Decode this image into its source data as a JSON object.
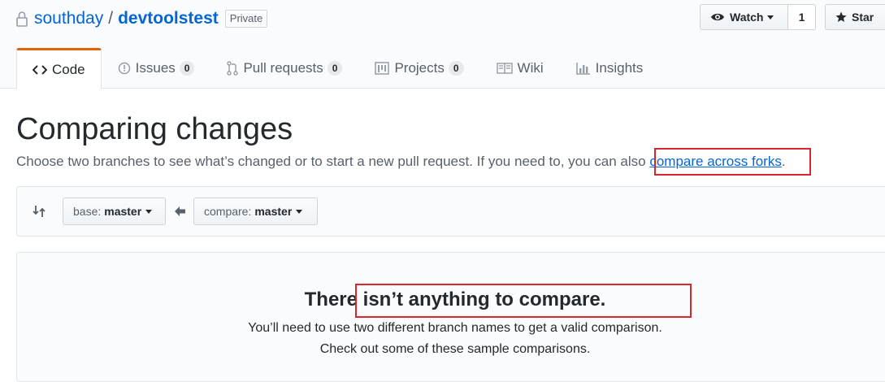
{
  "repo": {
    "owner": "southday",
    "separator": "/",
    "name": "devtoolstest",
    "visibility": "Private"
  },
  "actions": {
    "watch_label": "Watch",
    "watch_count": "1",
    "star_label": "Star"
  },
  "tabs": [
    {
      "label": "Code",
      "icon": "code-icon",
      "selected": true
    },
    {
      "label": "Issues",
      "count": "0",
      "icon": "issue-icon"
    },
    {
      "label": "Pull requests",
      "count": "0",
      "icon": "pull-request-icon"
    },
    {
      "label": "Projects",
      "count": "0",
      "icon": "project-icon"
    },
    {
      "label": "Wiki",
      "icon": "book-icon"
    },
    {
      "label": "Insights",
      "icon": "graph-icon"
    }
  ],
  "page": {
    "title": "Comparing changes",
    "subtitle_prefix": "Choose two branches to see what’s changed or to start a new pull request. If you need to, you can also ",
    "subtitle_link": "compare across forks",
    "subtitle_suffix": "."
  },
  "range": {
    "base_label": "base:",
    "base_value": "master",
    "compare_label": "compare:",
    "compare_value": "master"
  },
  "blankslate": {
    "title": "There isn’t anything to compare.",
    "line1": "You’ll need to use two different branch names to get a valid comparison.",
    "line2": "Check out some of these sample comparisons."
  },
  "colors": {
    "link": "#0366d6",
    "tab_accent": "#e36209",
    "highlight_box": "#d9262c"
  }
}
